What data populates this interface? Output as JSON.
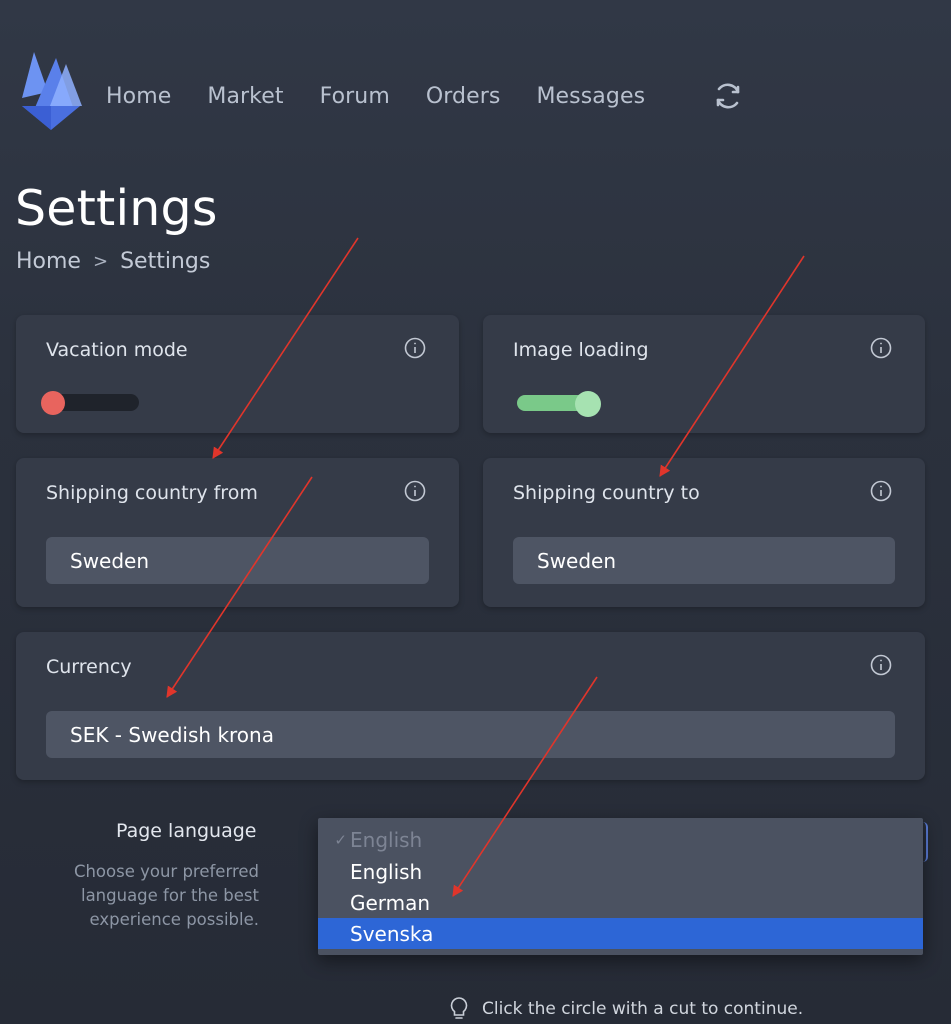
{
  "nav": {
    "items": [
      "Home",
      "Market",
      "Forum",
      "Orders",
      "Messages"
    ],
    "sync_icon": "sync-icon"
  },
  "page": {
    "title": "Settings",
    "breadcrumb": {
      "home": "Home",
      "separator": ">",
      "current": "Settings"
    }
  },
  "cards": {
    "vacation": {
      "label": "Vacation mode",
      "on": false
    },
    "image_loading": {
      "label": "Image loading",
      "on": true
    },
    "ship_from": {
      "label": "Shipping country from",
      "value": "Sweden"
    },
    "ship_to": {
      "label": "Shipping country to",
      "value": "Sweden"
    },
    "currency": {
      "label": "Currency",
      "value": "SEK - Swedish krona"
    }
  },
  "language": {
    "label": "Page language",
    "description": "Choose your preferred language for the best experience possible.",
    "options": [
      {
        "label": "English",
        "state": "current-disabled",
        "check": "✓"
      },
      {
        "label": "English",
        "state": "normal"
      },
      {
        "label": "German",
        "state": "normal"
      },
      {
        "label": "Svenska",
        "state": "highlighted"
      }
    ]
  },
  "hint": {
    "text": "Click the circle with a cut to continue."
  },
  "colors": {
    "background": "#2b313d",
    "card": "#353b48",
    "field": "#4e5564",
    "toggle_off_knob": "#e8645e",
    "toggle_on": "#7ac989",
    "highlight": "#2d66d6",
    "annotation_arrow": "#e0352b"
  }
}
